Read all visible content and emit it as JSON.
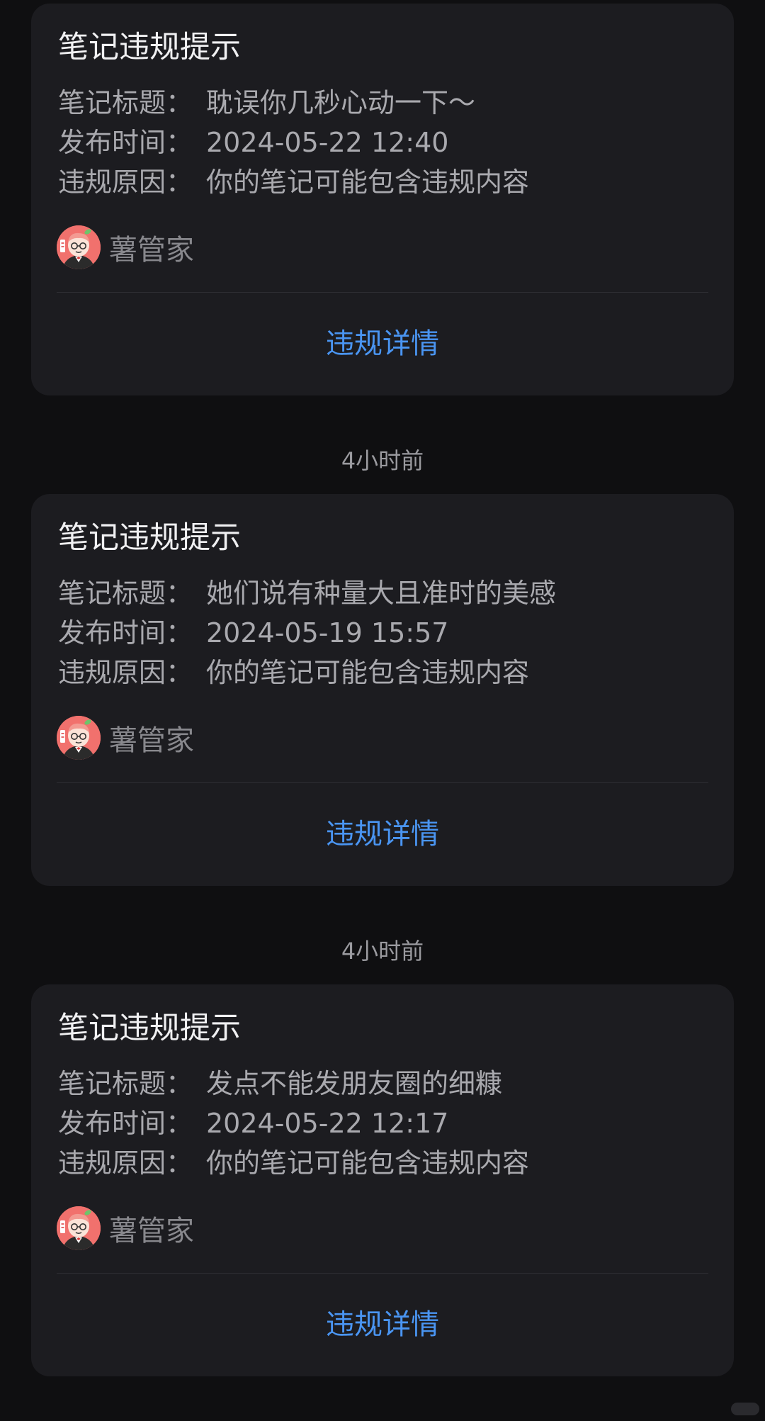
{
  "notices": [
    {
      "card_title": "笔记违规提示",
      "rows": [
        {
          "label": "笔记标题：",
          "value": "耽误你几秒心动一下～"
        },
        {
          "label": "发布时间：",
          "value": "2024-05-22 12:40"
        },
        {
          "label": "违规原因：",
          "value": "你的笔记可能包含违规内容"
        }
      ],
      "sender": "薯管家",
      "detail_link": "违规详情"
    },
    {
      "card_title": "笔记违规提示",
      "rows": [
        {
          "label": "笔记标题：",
          "value": "她们说有种量大且准时的美感"
        },
        {
          "label": "发布时间：",
          "value": "2024-05-19 15:57"
        },
        {
          "label": "违规原因：",
          "value": "你的笔记可能包含违规内容"
        }
      ],
      "sender": "薯管家",
      "detail_link": "违规详情"
    },
    {
      "card_title": "笔记违规提示",
      "rows": [
        {
          "label": "笔记标题：",
          "value": "发点不能发朋友圈的细糠"
        },
        {
          "label": "发布时间：",
          "value": "2024-05-22 12:17"
        },
        {
          "label": "违规原因：",
          "value": "你的笔记可能包含违规内容"
        }
      ],
      "sender": "薯管家",
      "detail_link": "违规详情"
    }
  ],
  "timestamps": [
    "4小时前",
    "4小时前"
  ],
  "icons": {
    "avatar": "shu-guanjia-avatar-icon"
  },
  "colors": {
    "background": "#0f0f11",
    "card": "#1c1c20",
    "link": "#4a95f2",
    "avatar": "#f1716d"
  }
}
